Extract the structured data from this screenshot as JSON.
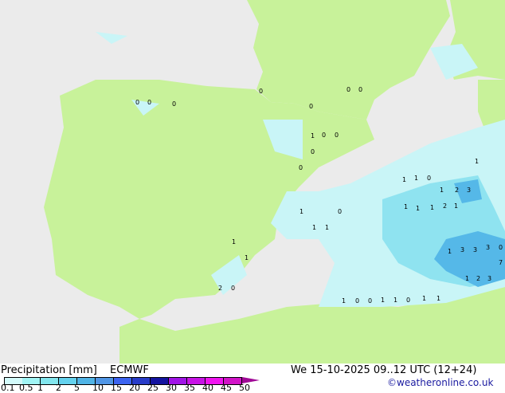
{
  "title": "Precipitation [mm]",
  "model": "ECMWF",
  "datetime": "We 15-10-2025 09..12 UTC (12+24)",
  "credit": "©weatheronline.co.uk",
  "colors": {
    "sea": "#ebebeb",
    "land": "#c8f29a",
    "rain_light": "#c9f5f7",
    "rain_mid": "#8fe3f0",
    "rain_heavy": "#55b8e8"
  },
  "scale": {
    "ticks": [
      "0.1",
      "0.5",
      "1",
      "2",
      "5",
      "10",
      "15",
      "20",
      "25",
      "30",
      "35",
      "40",
      "45",
      "50"
    ],
    "colors": [
      "#d2fafa",
      "#a0f5f5",
      "#82e6ee",
      "#64d2ee",
      "#50b4e6",
      "#5096e6",
      "#3c64f0",
      "#283cc8",
      "#1414a0",
      "#a014e6",
      "#c814e6",
      "#f014f0",
      "#d214c8",
      "#a00a96"
    ]
  },
  "map_labels": [
    "0",
    "0",
    "0",
    "0",
    "0",
    "0",
    "0",
    "1",
    "0",
    "0",
    "0",
    "0",
    "1",
    "1",
    "0",
    "1",
    "2",
    "3",
    "1",
    "1",
    "1",
    "2",
    "1",
    "1",
    "3",
    "3",
    "3",
    "0",
    "7",
    "1",
    "2",
    "3",
    "1",
    "1",
    "0",
    "1",
    "1",
    "1",
    "2",
    "0",
    "1",
    "0",
    "0",
    "1",
    "1",
    "0",
    "1",
    "1",
    "1"
  ]
}
